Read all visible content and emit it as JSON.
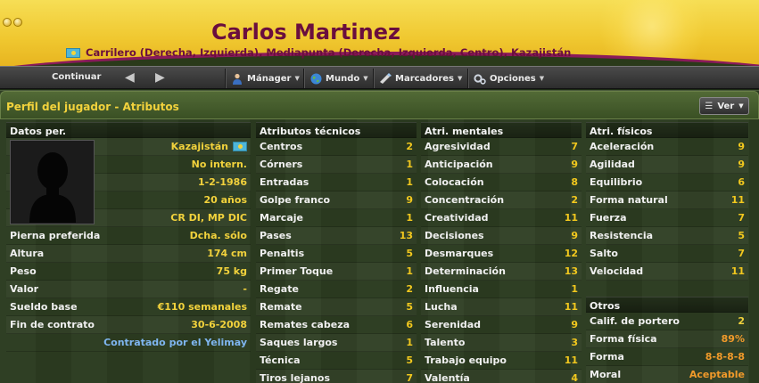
{
  "header": {
    "name": "Carlos Martinez",
    "positions": "Carrilero (Derecha, Izquierda), Mediapunta (Derecha, Izquierda, Centro), Kazajistán"
  },
  "toolbar": {
    "continue": "Continuar",
    "menus": [
      {
        "label": "Mánager",
        "icon": "manager-icon"
      },
      {
        "label": "Mundo",
        "icon": "globe-icon"
      },
      {
        "label": "Marcadores",
        "icon": "bookmark-icon"
      },
      {
        "label": "Opciones",
        "icon": "gears-icon"
      }
    ]
  },
  "panel": {
    "title": "Perfil del jugador - Atributos",
    "view_button": "Ver"
  },
  "personal": {
    "header": "Datos per.",
    "photo_rows": [
      {
        "value": "Kazajistán"
      },
      {
        "value": "No intern."
      },
      {
        "value": "1-2-1986"
      },
      {
        "value": "20 años"
      },
      {
        "value": "CR DI, MP DIC"
      }
    ],
    "rows": [
      {
        "label": "Pierna preferida",
        "value": "Dcha. sólo"
      },
      {
        "label": "Altura",
        "value": "174 cm"
      },
      {
        "label": "Peso",
        "value": "75 kg"
      },
      {
        "label": "Valor",
        "value": "-"
      },
      {
        "label": "Sueldo base",
        "value": "€110 semanales"
      },
      {
        "label": "Fin de contrato",
        "value": "30-6-2008"
      }
    ],
    "contract_note": "Contratado por el Yelimay"
  },
  "technical": {
    "header": "Atributos técnicos",
    "rows": [
      {
        "label": "Centros",
        "value": "2"
      },
      {
        "label": "Córners",
        "value": "1"
      },
      {
        "label": "Entradas",
        "value": "1"
      },
      {
        "label": "Golpe franco",
        "value": "9"
      },
      {
        "label": "Marcaje",
        "value": "1"
      },
      {
        "label": "Pases",
        "value": "13"
      },
      {
        "label": "Penaltis",
        "value": "5"
      },
      {
        "label": "Primer Toque",
        "value": "1"
      },
      {
        "label": "Regate",
        "value": "2"
      },
      {
        "label": "Remate",
        "value": "5"
      },
      {
        "label": "Remates cabeza",
        "value": "6"
      },
      {
        "label": "Saques largos",
        "value": "1"
      },
      {
        "label": "Técnica",
        "value": "5"
      },
      {
        "label": "Tiros lejanos",
        "value": "7"
      }
    ]
  },
  "mental": {
    "header": "Atri. mentales",
    "rows": [
      {
        "label": "Agresividad",
        "value": "7"
      },
      {
        "label": "Anticipación",
        "value": "9"
      },
      {
        "label": "Colocación",
        "value": "8"
      },
      {
        "label": "Concentración",
        "value": "2"
      },
      {
        "label": "Creatividad",
        "value": "11"
      },
      {
        "label": "Decisiones",
        "value": "9"
      },
      {
        "label": "Desmarques",
        "value": "12"
      },
      {
        "label": "Determinación",
        "value": "13"
      },
      {
        "label": "Influencia",
        "value": "1"
      },
      {
        "label": "Lucha",
        "value": "11"
      },
      {
        "label": "Serenidad",
        "value": "9"
      },
      {
        "label": "Talento",
        "value": "3"
      },
      {
        "label": "Trabajo equipo",
        "value": "11"
      },
      {
        "label": "Valentía",
        "value": "4"
      }
    ]
  },
  "physical": {
    "header": "Atri. físicos",
    "rows": [
      {
        "label": "Aceleración",
        "value": "9"
      },
      {
        "label": "Agilidad",
        "value": "9"
      },
      {
        "label": "Equilibrio",
        "value": "6"
      },
      {
        "label": "Forma natural",
        "value": "11"
      },
      {
        "label": "Fuerza",
        "value": "7"
      },
      {
        "label": "Resistencia",
        "value": "5"
      },
      {
        "label": "Salto",
        "value": "7"
      },
      {
        "label": "Velocidad",
        "value": "11"
      }
    ]
  },
  "others": {
    "header": "Otros",
    "rows": [
      {
        "label": "Calif. de portero",
        "value": "2"
      },
      {
        "label": "Forma física",
        "value": "89%"
      },
      {
        "label": "Forma",
        "value": "8-8-8-8"
      },
      {
        "label": "Moral",
        "value": "Aceptable"
      }
    ]
  },
  "colors": {
    "accent_yellow": "#f2d23c",
    "accent_orange": "#f19a2a",
    "name_purple": "#6a0e3e",
    "link_blue": "#7fb6f0"
  }
}
